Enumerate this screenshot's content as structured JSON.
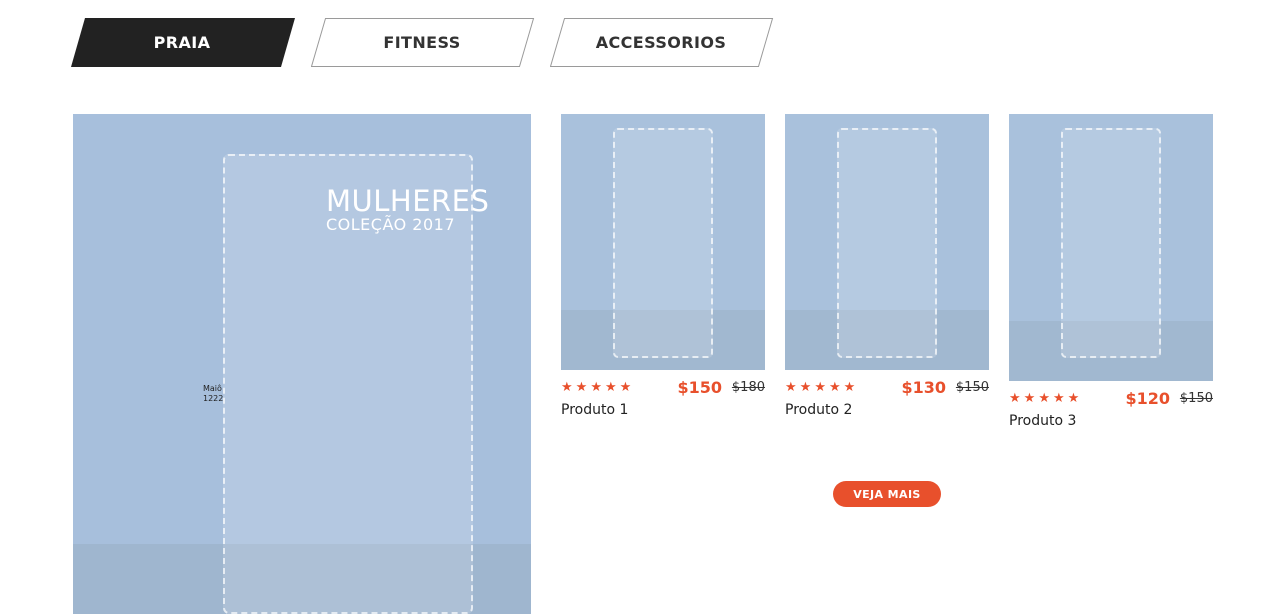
{
  "tabs": [
    {
      "label": "PRAIA",
      "active": true
    },
    {
      "label": "FITNESS",
      "active": false
    },
    {
      "label": "ACCESSORIOS",
      "active": false
    }
  ],
  "featured": {
    "title": "MULHERES",
    "subtitle": "COLEÇÃO 2017",
    "tag_line1": "Maiô",
    "tag_line2": "1222"
  },
  "products": [
    {
      "name": "Produto 1",
      "price": "$150",
      "old_price": "$180",
      "rating": 5
    },
    {
      "name": "Produto 2",
      "price": "$130",
      "old_price": "$150",
      "rating": 5
    },
    {
      "name": "Produto 3",
      "price": "$120",
      "old_price": "$150",
      "rating": 5
    }
  ],
  "cta": {
    "label": "VEJA MAIS"
  },
  "colors": {
    "accent": "#e8502c",
    "tab_active_bg": "#222222",
    "tab_border": "#9a9a9a",
    "sky": "#a9c1dc"
  },
  "icons": {
    "star": "star-icon"
  }
}
